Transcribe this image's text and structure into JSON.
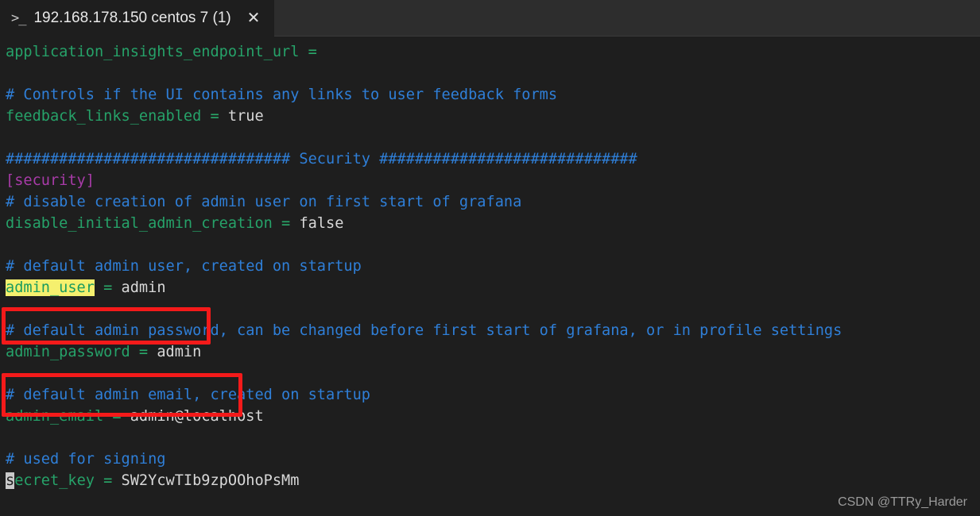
{
  "window": {
    "tab": {
      "icon": "prompt-icon",
      "icon_glyph": ">_",
      "title": "192.168.178.150 centos 7 (1)",
      "close_glyph": "✕"
    }
  },
  "terminal": {
    "background": "#1e1e1e",
    "colors": {
      "key_green": "#26a269",
      "comment_blue": "#2f7fd8",
      "value_white": "#d8d8d8",
      "section_magenta": "#a83ba8",
      "highlight_yellow": "#f5f06e",
      "annotation_red": "#f41a1a",
      "cursor_gray": "#c9c9c9"
    },
    "lines": [
      {
        "id": "line-1",
        "segments": [
          {
            "cls": "c-key",
            "text": "application_insights_endpoint_url"
          },
          {
            "cls": "c-op",
            "text": " ="
          }
        ]
      },
      {
        "id": "line-2",
        "segments": []
      },
      {
        "id": "line-3",
        "segments": [
          {
            "cls": "c-comment",
            "text": "# Controls if the UI contains any links to user feedback forms"
          }
        ]
      },
      {
        "id": "line-4",
        "segments": [
          {
            "cls": "c-key",
            "text": "feedback_links_enabled"
          },
          {
            "cls": "c-op",
            "text": " = "
          },
          {
            "cls": "c-value",
            "text": "true"
          }
        ]
      },
      {
        "id": "line-5",
        "segments": []
      },
      {
        "id": "line-6",
        "segments": [
          {
            "cls": "c-hash",
            "text": "################################ Security #############################"
          }
        ]
      },
      {
        "id": "line-7",
        "segments": [
          {
            "cls": "c-section",
            "text": "[security]"
          }
        ]
      },
      {
        "id": "line-8",
        "segments": [
          {
            "cls": "c-comment",
            "text": "# disable creation of admin user on first start of grafana"
          }
        ]
      },
      {
        "id": "line-9",
        "segments": [
          {
            "cls": "c-key",
            "text": "disable_initial_admin_creation"
          },
          {
            "cls": "c-op",
            "text": " = "
          },
          {
            "cls": "c-value",
            "text": "false"
          }
        ]
      },
      {
        "id": "line-10",
        "segments": []
      },
      {
        "id": "line-11",
        "segments": [
          {
            "cls": "c-comment",
            "text": "# default admin user, created on startup"
          }
        ]
      },
      {
        "id": "line-12",
        "segments": [
          {
            "cls": "hl-yellow",
            "text": "admin_user"
          },
          {
            "cls": "c-op",
            "text": " = "
          },
          {
            "cls": "c-value",
            "text": "admin"
          }
        ]
      },
      {
        "id": "line-13",
        "segments": []
      },
      {
        "id": "line-14",
        "segments": [
          {
            "cls": "c-comment",
            "text": "# default admin password, can be changed before first start of grafana, or in profile settings"
          }
        ]
      },
      {
        "id": "line-15",
        "segments": [
          {
            "cls": "c-key",
            "text": "admin_password"
          },
          {
            "cls": "c-op",
            "text": " = "
          },
          {
            "cls": "c-value",
            "text": "admin"
          }
        ]
      },
      {
        "id": "line-16",
        "segments": []
      },
      {
        "id": "line-17",
        "segments": [
          {
            "cls": "c-comment",
            "text": "# default admin email, created on startup"
          }
        ]
      },
      {
        "id": "line-18",
        "segments": [
          {
            "cls": "c-key",
            "text": "admin_email"
          },
          {
            "cls": "c-op",
            "text": " = "
          },
          {
            "cls": "c-value",
            "text": "admin@localhost"
          }
        ]
      },
      {
        "id": "line-19",
        "segments": []
      },
      {
        "id": "line-20",
        "segments": [
          {
            "cls": "c-comment",
            "text": "# used for signing"
          }
        ]
      },
      {
        "id": "line-21",
        "segments": [
          {
            "cls": "cursor",
            "text": "s"
          },
          {
            "cls": "c-key",
            "text": "ecret_key"
          },
          {
            "cls": "c-op",
            "text": " = "
          },
          {
            "cls": "c-value",
            "text": "SW2YcwTIb9zpOOhoPsMm"
          }
        ]
      }
    ]
  },
  "annotations": [
    {
      "id": "annot-admin-user",
      "label": "admin-user-highlight-box"
    },
    {
      "id": "annot-admin-password",
      "label": "admin-password-highlight-box"
    }
  ],
  "watermark": {
    "text": "CSDN @TTRy_Harder"
  }
}
